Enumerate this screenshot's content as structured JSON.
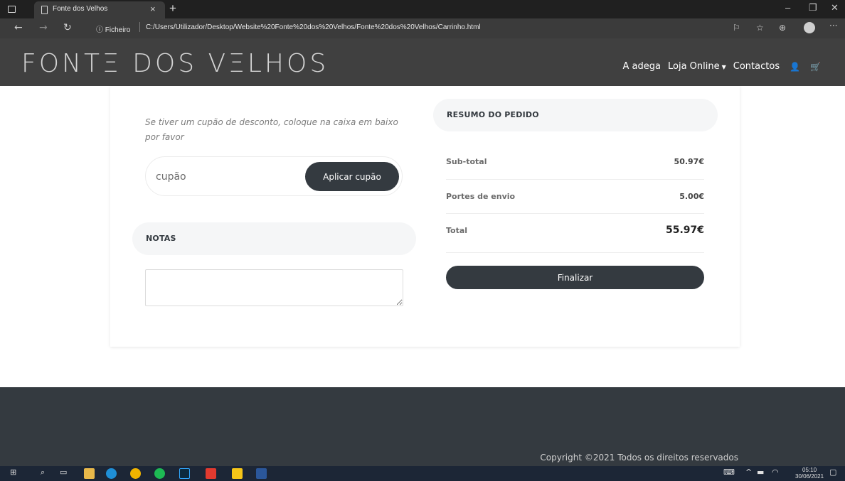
{
  "browser": {
    "tab_title": "Fonte dos Velhos",
    "tab_close": "×",
    "new_tab": "+",
    "url_scheme_label": "ⓘ Ficheiro",
    "url": "C:/Users/Utilizador/Desktop/Website%20Fonte%20dos%20Velhos/Fonte%20dos%20Velhos/Carrinho.html",
    "icons": [
      "window-icon",
      "page-icon",
      "back-icon",
      "forward-icon",
      "refresh-icon",
      "read-aloud-icon",
      "favorites-icon",
      "collections-icon",
      "profile-icon",
      "more-icon"
    ]
  },
  "header": {
    "logo": "FONTΞ DOS VΞLHOS",
    "nav": {
      "adega": "A adega",
      "loja": "Loja Online",
      "contactos": "Contactos"
    }
  },
  "coupon": {
    "instruction": "Se tiver um cupão de desconto, coloque na caixa em baixo por favor",
    "placeholder": "cupão",
    "button": "Aplicar cupão"
  },
  "notes": {
    "title": "NOTAS",
    "value": ""
  },
  "summary": {
    "title": "RESUMO DO PEDIDO",
    "rows": [
      {
        "label": "Sub-total",
        "value": "50.97€"
      },
      {
        "label": "Portes de envio",
        "value": "5.00€"
      },
      {
        "label": "Total",
        "value": "55.97€"
      }
    ],
    "button": "Finalizar"
  },
  "footer": {
    "copyright": "Copyright ©2021 Todos os direitos reservados"
  },
  "taskbar": {
    "time": "05:10",
    "date": "30/06/2021"
  },
  "colors": {
    "header_bg": "#404040",
    "button_dark": "#343a40",
    "footer_bg": "#343a40",
    "pill_bg": "#f5f6f7"
  }
}
